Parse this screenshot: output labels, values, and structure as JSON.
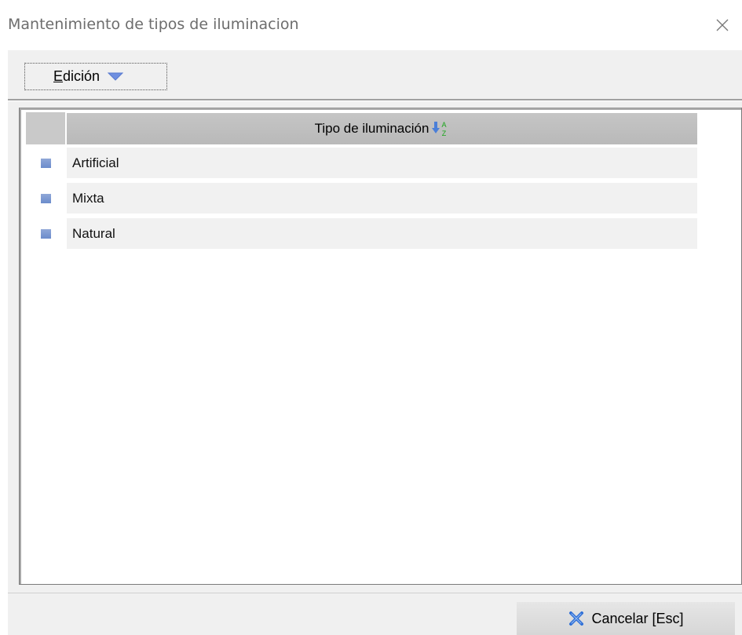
{
  "window": {
    "title": "Mantenimiento de tipos de iluminacion"
  },
  "toolbar": {
    "edicion_label": "Edición"
  },
  "grid": {
    "column_header": "Tipo de iluminación",
    "rows": [
      {
        "value": "Artificial"
      },
      {
        "value": "Mixta"
      },
      {
        "value": "Natural"
      }
    ]
  },
  "footer": {
    "cancel_label": "Cancelar [Esc]"
  },
  "colors": {
    "row_marker": "#7393d0",
    "header_bg": "#c0c0c0",
    "row_bg": "#f1f1f1",
    "dropdown_arrow": "#6f8fe0",
    "cancel_icon": "#2f6fd6"
  },
  "icons": {
    "close": "close-icon",
    "dropdown": "chevron-down-icon",
    "sort": "sort-az-icon",
    "cancel": "cancel-x-icon"
  }
}
